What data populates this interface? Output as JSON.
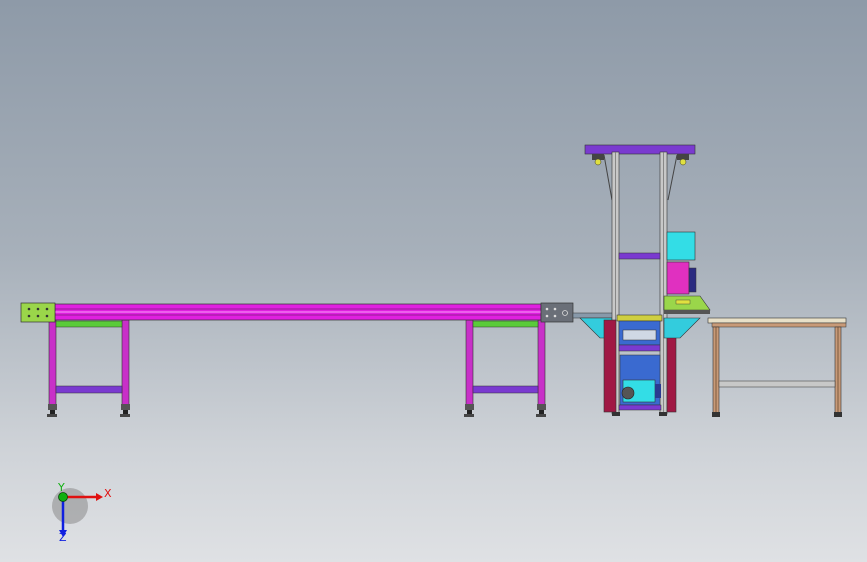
{
  "axis_triad": {
    "x_label": "X",
    "y_label": "Y",
    "z_label": "Z",
    "x_color": "#e01010",
    "y_color": "#10b010",
    "z_color": "#1020e0"
  },
  "colors": {
    "background_top": "#8e9aa8",
    "background_bottom": "#dfe1e4",
    "conveyor_rail": "#e020e0",
    "frame_leg": "#c830c8",
    "frame_crossbar": "#7a3ad0",
    "green_brace": "#5acb3a",
    "end_plate_green": "#9ad64a",
    "end_plate_gray": "#6a6f78",
    "elevator_column": "#c8c8c8",
    "cyan_box": "#33dde6",
    "magenta_box": "#e030c0",
    "table_frame": "#c89a78"
  },
  "components": {
    "long_conveyor": "long-belt-conveyor",
    "elevator": "vertical-lift-station",
    "side_table": "outfeed-table"
  }
}
